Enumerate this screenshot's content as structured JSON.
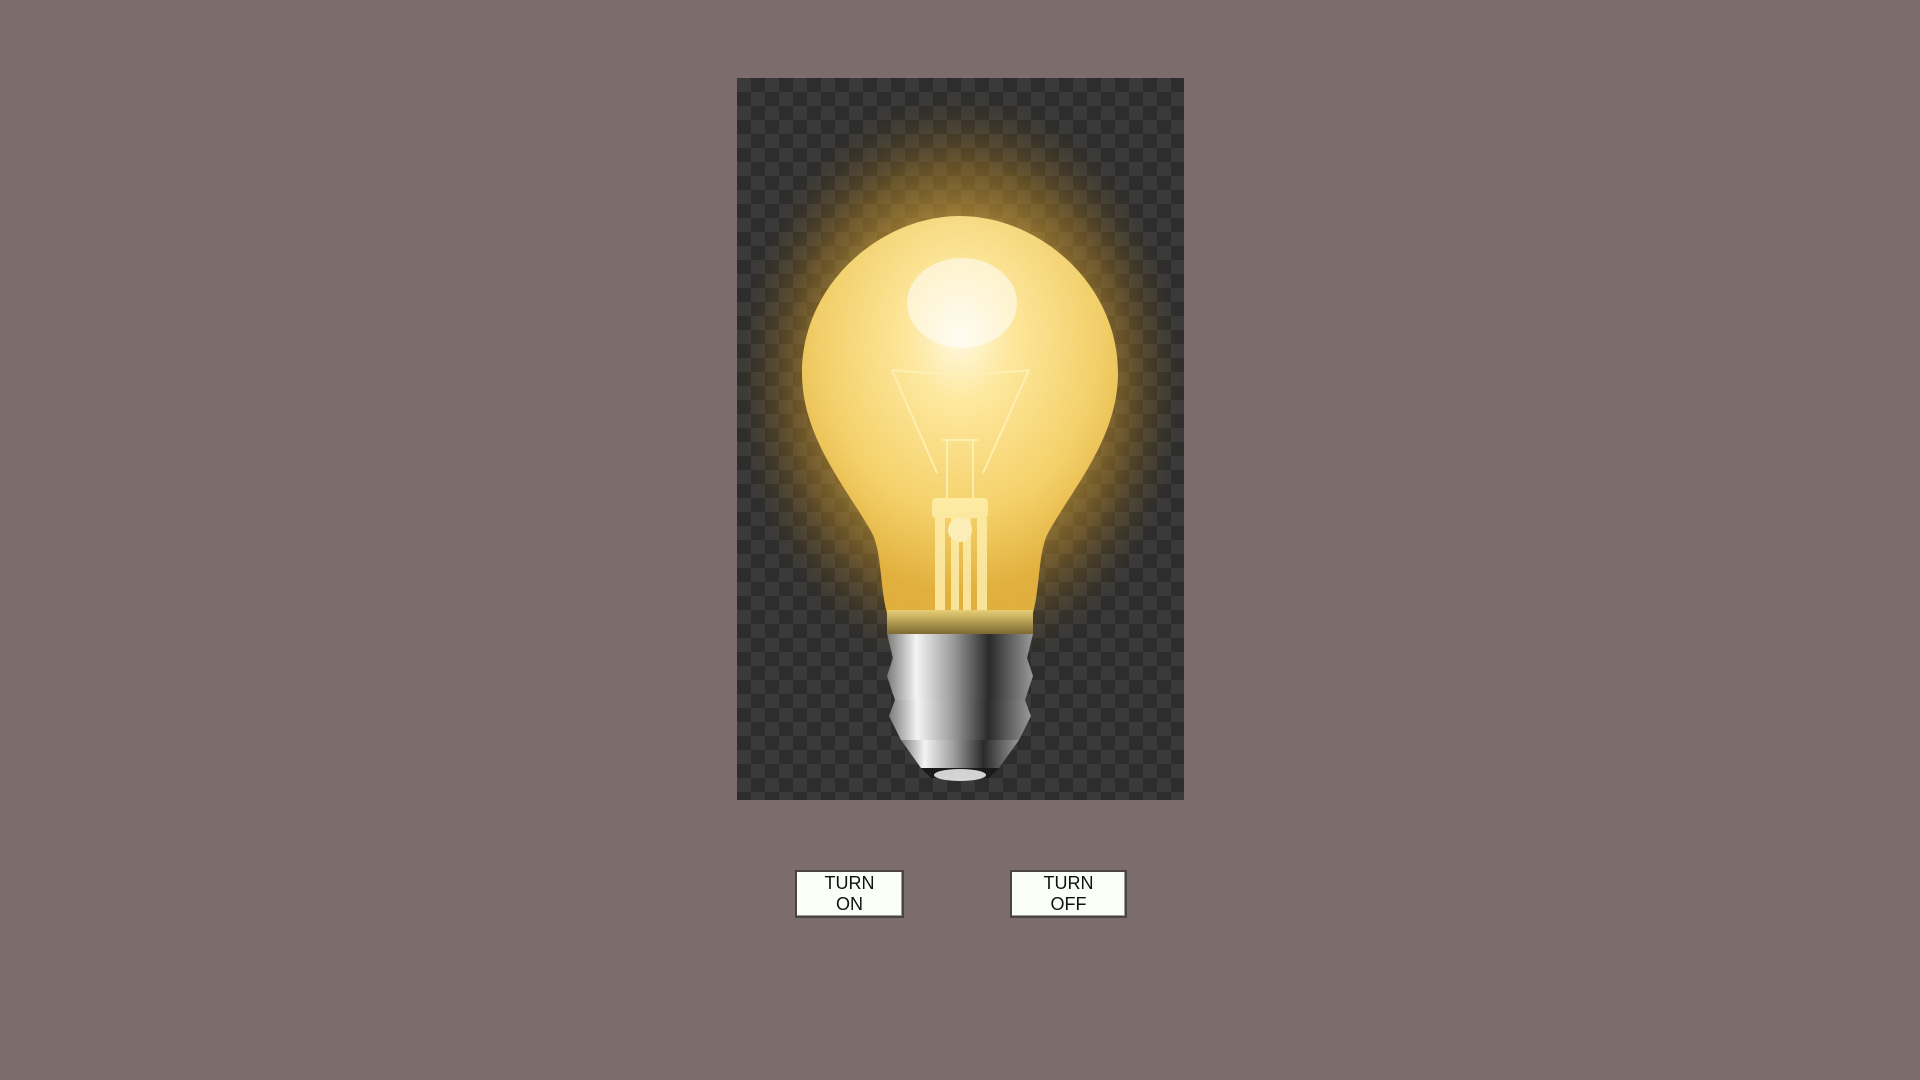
{
  "page": {
    "background_color": "#7c6c6c"
  },
  "bulb": {
    "state": "on",
    "icon": "light-bulb-icon",
    "glow_color": "#ffd866"
  },
  "controls": {
    "turn_on_label": "TURN ON",
    "turn_off_label": "TURN OFF"
  }
}
